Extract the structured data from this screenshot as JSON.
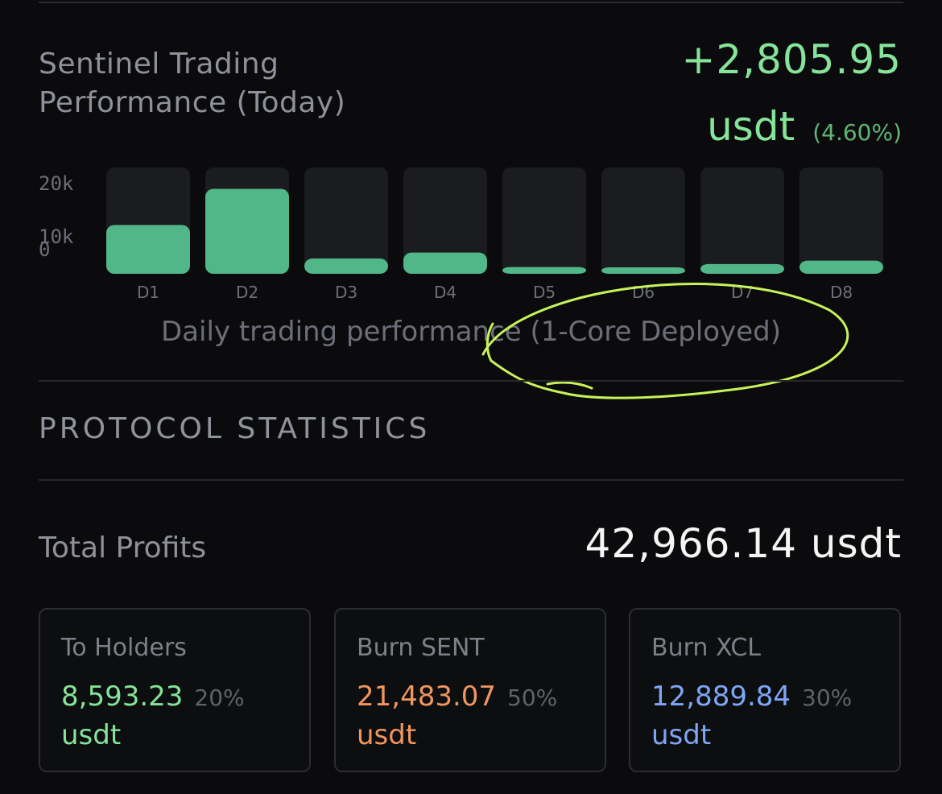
{
  "performance": {
    "title": "Sentinel Trading Performance (Today)",
    "amount": "+2,805.95",
    "unit": "usdt",
    "percent": "(4.60%)"
  },
  "chart_data": {
    "type": "bar",
    "categories": [
      "D1",
      "D2",
      "D3",
      "D4",
      "D5",
      "D6",
      "D7",
      "D8"
    ],
    "values": [
      11500,
      20000,
      3600,
      5000,
      1600,
      1300,
      2300,
      3100
    ],
    "yticks": [
      "20k",
      "10k",
      "0"
    ],
    "ylim": [
      0,
      22000
    ],
    "caption": "Daily trading performance (1-Core Deployed)",
    "colors": {
      "bar": "#52b788",
      "track": "#1b1c1f",
      "text": "#6c6f78"
    }
  },
  "protocol": {
    "title": "PROTOCOL STATISTICS",
    "total_label": "Total Profits",
    "total_value": "42,966.14 usdt",
    "cards": [
      {
        "label": "To Holders",
        "value": "8,593.23",
        "pct": "20%",
        "unit": "usdt",
        "color": "#86e39a"
      },
      {
        "label": "Burn SENT",
        "value": "21,483.07",
        "pct": "50%",
        "unit": "usdt",
        "color": "#f0965f"
      },
      {
        "label": "Burn XCL",
        "value": "12,889.84",
        "pct": "30%",
        "unit": "usdt",
        "color": "#7fa6f5"
      }
    ]
  },
  "annotation": {
    "color": "#c8f25a"
  }
}
